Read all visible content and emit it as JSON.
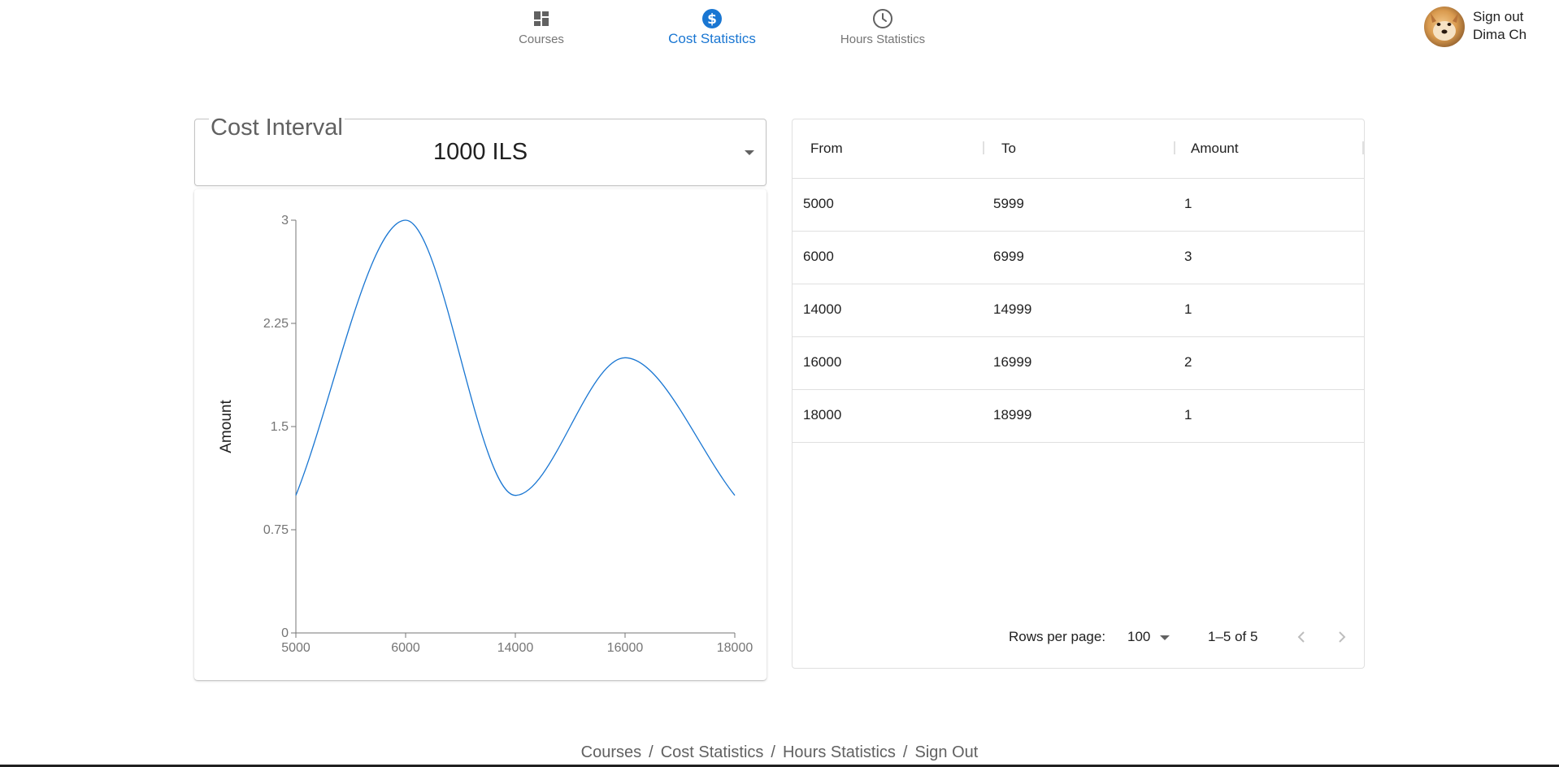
{
  "nav": {
    "items": [
      {
        "label": "Courses",
        "icon": "dashboard-icon"
      },
      {
        "label": "Cost Statistics",
        "icon": "dollar-icon"
      },
      {
        "label": "Hours Statistics",
        "icon": "clock-icon"
      }
    ],
    "active": 1,
    "active_color": "#1976d2"
  },
  "user": {
    "signout_label": "Sign out",
    "name": "Dima Ch"
  },
  "cost_interval": {
    "label": "Cost Interval",
    "value": "1000 ILS"
  },
  "chart_data": {
    "type": "line",
    "x": [
      5000,
      6000,
      14000,
      16000,
      18000
    ],
    "values": [
      1,
      3,
      1,
      2,
      1
    ],
    "x_tick_labels": [
      "5000",
      "6000",
      "14000",
      "16000",
      "18000"
    ],
    "y_ticks": [
      0,
      0.75,
      1.5,
      2.25,
      3
    ],
    "y_tick_labels": [
      "0",
      "0.75",
      "1.5",
      "2.25",
      "3"
    ],
    "ylim": [
      0,
      3
    ],
    "xlabel": "",
    "ylabel": "Amount",
    "curve": "smooth",
    "x_scale": "categorical",
    "grid": false,
    "line_color": "#1976d2"
  },
  "table": {
    "columns": [
      "From",
      "To",
      "Amount"
    ],
    "rows": [
      [
        "5000",
        "5999",
        "1"
      ],
      [
        "6000",
        "6999",
        "3"
      ],
      [
        "14000",
        "14999",
        "1"
      ],
      [
        "16000",
        "16999",
        "2"
      ],
      [
        "18000",
        "18999",
        "1"
      ]
    ],
    "pagination": {
      "rows_per_page_label": "Rows per page:",
      "rows_per_page": "100",
      "range": "1–5 of 5"
    }
  },
  "footer": {
    "links": [
      "Courses",
      "Cost Statistics",
      "Hours Statistics",
      "Sign Out"
    ],
    "separator": "/"
  }
}
